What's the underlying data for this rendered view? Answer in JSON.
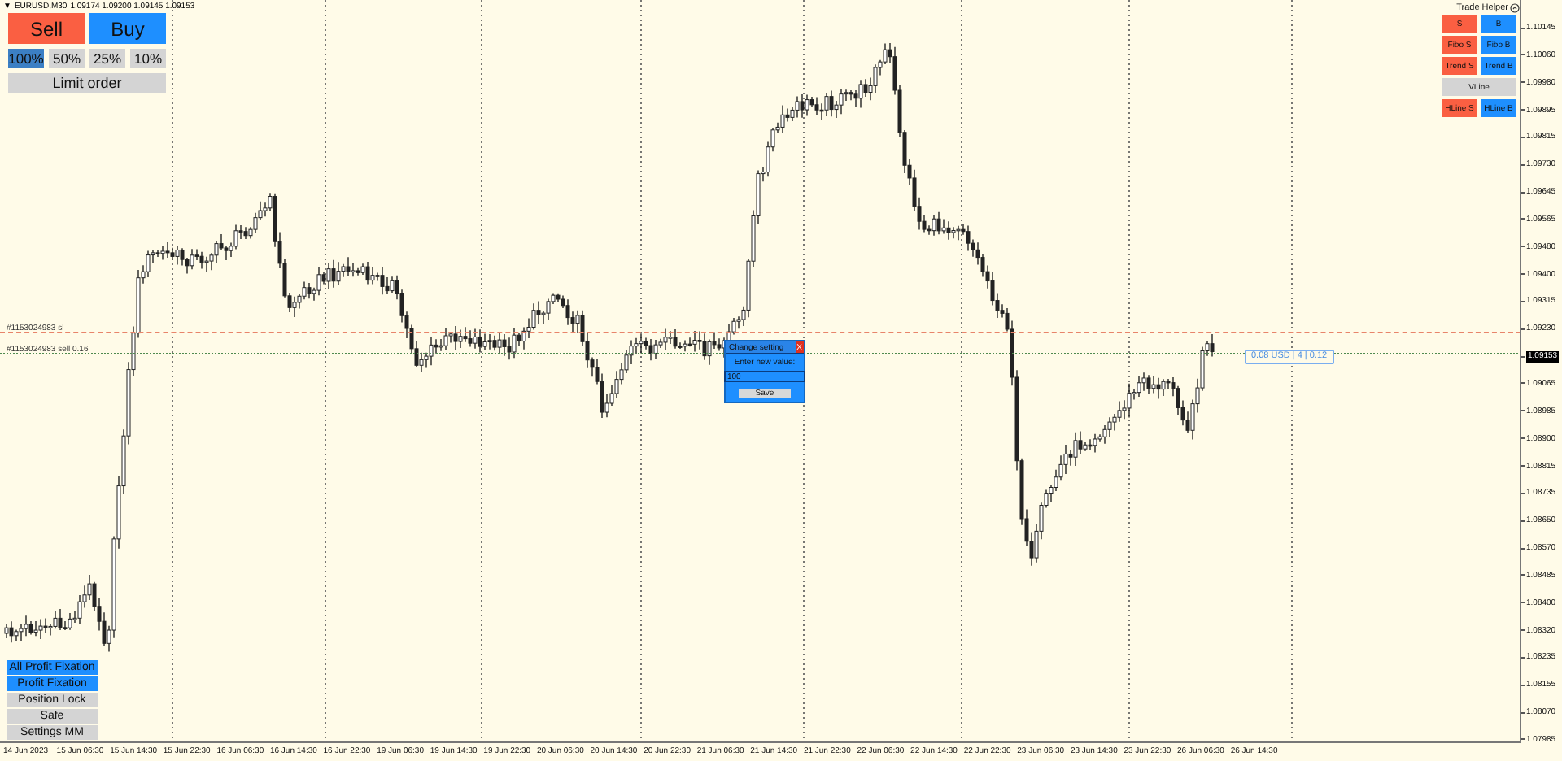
{
  "chart": {
    "header": {
      "collapse_glyph": "▼",
      "symbol": "EURUSD,M30",
      "quotes": "1.09174 1.09200 1.09145 1.09153"
    },
    "order_lines": [
      {
        "kind": "stop",
        "label": "#1153024983 sl",
        "color": "#e8846a"
      },
      {
        "kind": "entry",
        "label": "#1153024983 sell 0.16",
        "color": "#4f8a4f"
      }
    ],
    "profit_label": "0.08 USD | 4 | 0.12"
  },
  "trade_panel": {
    "sell": "Sell",
    "buy": "Buy",
    "percents": [
      {
        "label": "100%",
        "selected": true
      },
      {
        "label": "50%",
        "selected": false
      },
      {
        "label": "25%",
        "selected": false
      },
      {
        "label": "10%",
        "selected": false
      }
    ],
    "limit_order": "Limit order"
  },
  "bottom_buttons": [
    {
      "label": "All Profit Fixation",
      "kind": "primary"
    },
    {
      "label": "Profit Fixation",
      "kind": "primary"
    },
    {
      "label": "Position Lock",
      "kind": "secondary"
    },
    {
      "label": "Safe",
      "kind": "secondary"
    },
    {
      "label": "Settings MM",
      "kind": "secondary"
    }
  ],
  "trade_helper": {
    "title": "Trade Helper",
    "buttons": [
      {
        "label": "S",
        "kind": "sell"
      },
      {
        "label": "B",
        "kind": "buy"
      },
      {
        "label": "Fibo S",
        "kind": "sell"
      },
      {
        "label": "Fibo B",
        "kind": "buy"
      },
      {
        "label": "Trend S",
        "kind": "sell"
      },
      {
        "label": "Trend B",
        "kind": "buy"
      },
      {
        "label": "VLine",
        "kind": "neutral"
      },
      {
        "label": "HLine S",
        "kind": "sell"
      },
      {
        "label": "HLine B",
        "kind": "buy"
      }
    ]
  },
  "dialog": {
    "title": "Change setting",
    "close": "X",
    "prompt": "Enter new value:",
    "value": "100",
    "save": "Save"
  },
  "price_axis": {
    "labels": [
      {
        "text": "1.10145",
        "kind": "tick"
      },
      {
        "text": "1.10060",
        "kind": "tick"
      },
      {
        "text": "1.09980",
        "kind": "tick"
      },
      {
        "text": "1.09895",
        "kind": "tick"
      },
      {
        "text": "1.09815",
        "kind": "tick"
      },
      {
        "text": "1.09730",
        "kind": "tick"
      },
      {
        "text": "1.09645",
        "kind": "tick"
      },
      {
        "text": "1.09565",
        "kind": "tick"
      },
      {
        "text": "1.09480",
        "kind": "tick"
      },
      {
        "text": "1.09400",
        "kind": "tick"
      },
      {
        "text": "1.09315",
        "kind": "tick"
      },
      {
        "text": "1.09230",
        "kind": "tick"
      },
      {
        "text": "1.09153",
        "kind": "current"
      },
      {
        "text": "1.09065",
        "kind": "tick"
      },
      {
        "text": "1.08985",
        "kind": "tick"
      },
      {
        "text": "1.08900",
        "kind": "tick"
      },
      {
        "text": "1.08815",
        "kind": "tick"
      },
      {
        "text": "1.08735",
        "kind": "tick"
      },
      {
        "text": "1.08650",
        "kind": "tick"
      },
      {
        "text": "1.08570",
        "kind": "tick"
      },
      {
        "text": "1.08485",
        "kind": "tick"
      },
      {
        "text": "1.08400",
        "kind": "tick"
      },
      {
        "text": "1.08320",
        "kind": "tick"
      },
      {
        "text": "1.08235",
        "kind": "tick"
      },
      {
        "text": "1.08155",
        "kind": "tick"
      },
      {
        "text": "1.08070",
        "kind": "tick"
      },
      {
        "text": "1.07985",
        "kind": "tick"
      }
    ]
  },
  "time_axis": {
    "labels": [
      "14 Jun 2023",
      "15 Jun 06:30",
      "15 Jun 14:30",
      "15 Jun 22:30",
      "16 Jun 06:30",
      "16 Jun 14:30",
      "16 Jun 22:30",
      "19 Jun 06:30",
      "19 Jun 14:30",
      "19 Jun 22:30",
      "20 Jun 06:30",
      "20 Jun 14:30",
      "20 Jun 22:30",
      "21 Jun 06:30",
      "21 Jun 14:30",
      "21 Jun 22:30",
      "22 Jun 06:30",
      "22 Jun 14:30",
      "22 Jun 22:30",
      "23 Jun 06:30",
      "23 Jun 14:30",
      "23 Jun 22:30",
      "26 Jun 06:30",
      "26 Jun 14:30"
    ]
  }
}
